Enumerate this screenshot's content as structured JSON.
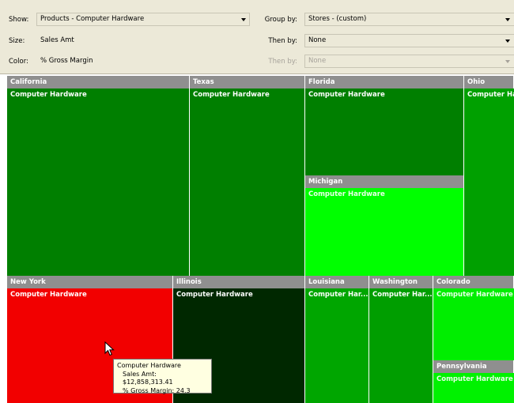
{
  "toolbar": {
    "show_label": "Show:",
    "show_value": "Products - Computer Hardware",
    "size_label": "Size:",
    "size_value": "Sales Amt",
    "color_label": "Color:",
    "color_value": "% Gross Margin",
    "groupby_label": "Group by:",
    "groupby_value": "Stores - (custom)",
    "thenby1_label": "Then by:",
    "thenby1_value": "None",
    "thenby2_label": "Then by:",
    "thenby2_value": "None"
  },
  "treemap": {
    "tiles": [
      {
        "state": "California",
        "product": "Computer Hardware",
        "color": "#007f00"
      },
      {
        "state": "Texas",
        "product": "Computer Hardware",
        "color": "#007f00"
      },
      {
        "state": "Florida",
        "product": "Computer Hardware",
        "color": "#007f00"
      },
      {
        "state": "Ohio",
        "product": "Computer Ha",
        "color": "#00a000"
      },
      {
        "state": "Michigan",
        "product": "Computer Hardware",
        "color": "#00ff00"
      },
      {
        "state": "New York",
        "product": "Computer Hardware",
        "color": "#f20000"
      },
      {
        "state": "Illinois",
        "product": "Computer Hardware",
        "color": "#002800"
      },
      {
        "state": "Louisiana",
        "product": "Computer Har...",
        "color": "#00a600"
      },
      {
        "state": "Washington",
        "product": "Computer Har...",
        "color": "#009e00"
      },
      {
        "state": "Colorado",
        "product": "Computer Hardware",
        "color": "#00ee00"
      },
      {
        "state": "Pennsylvania",
        "product": "Computer Hardware",
        "color": "#00f200"
      }
    ],
    "header_color": "#8f8f8f"
  },
  "tooltip": {
    "line1": "Computer Hardware",
    "line2": "Sales Amt: $12,858,313.41",
    "line3": "% Gross Margin: 24.3"
  }
}
